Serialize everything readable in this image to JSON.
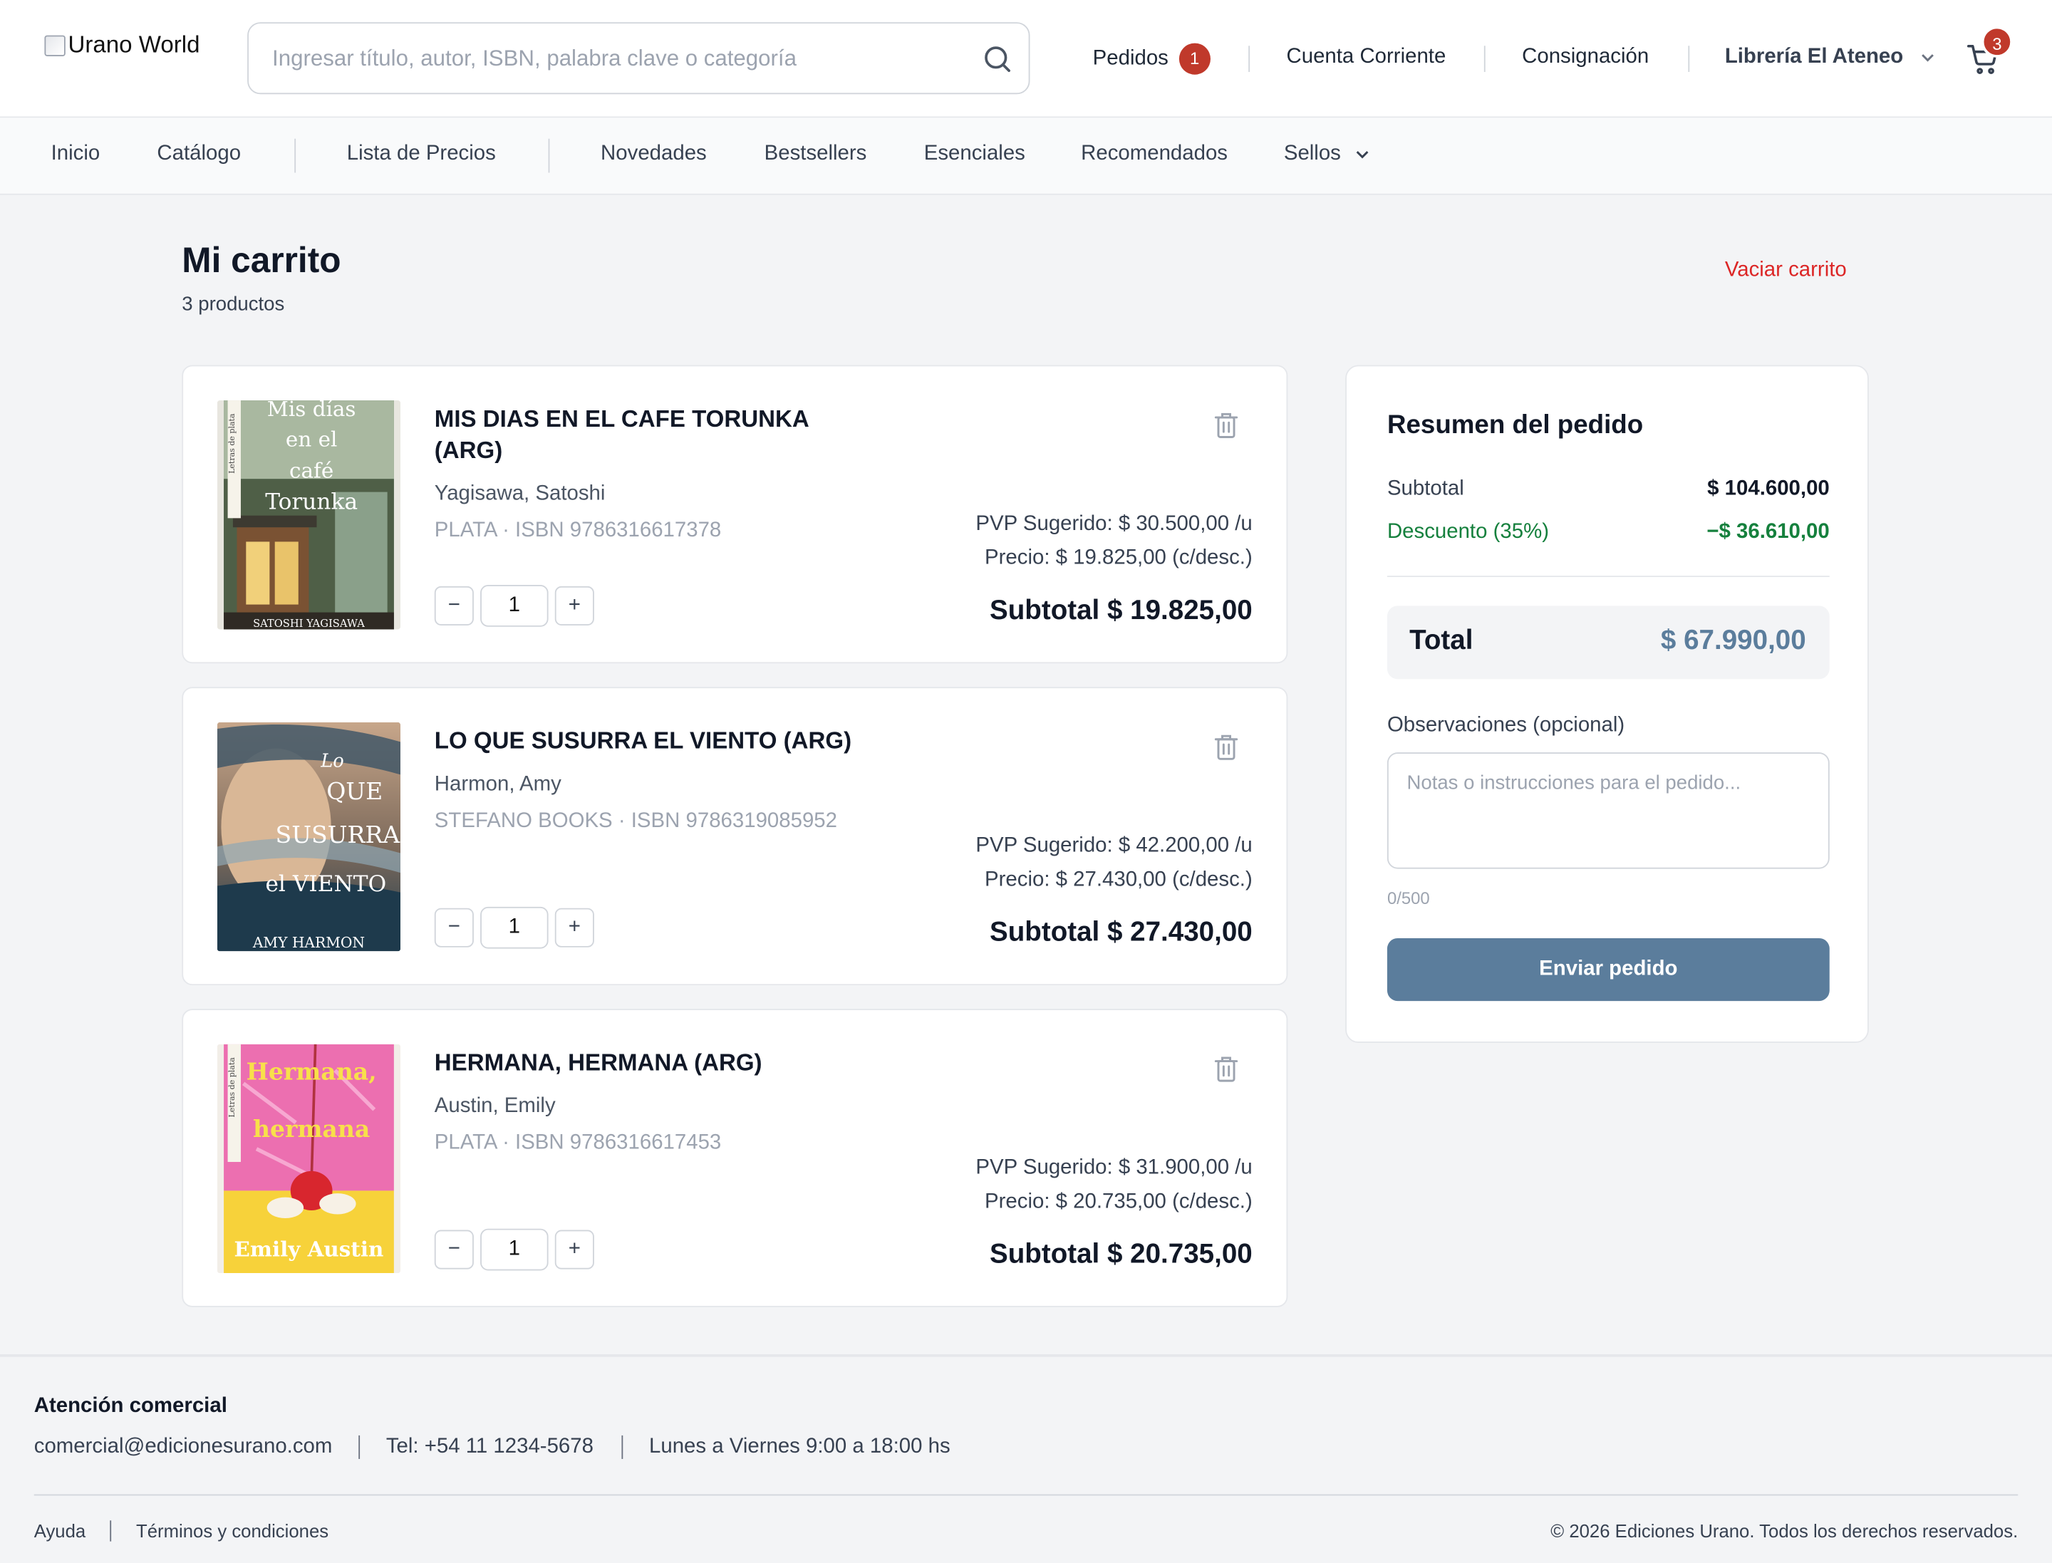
{
  "header": {
    "logo_alt": "Urano World",
    "search_placeholder": "Ingresar título, autor, ISBN, palabra clave o categoría",
    "nav": {
      "pedidos": "Pedidos",
      "pedidos_badge": "1",
      "cuenta": "Cuenta Corriente",
      "consignacion": "Consignación",
      "account": "Librería El Ateneo",
      "cart_badge": "3"
    }
  },
  "catbar": {
    "items": [
      "Inicio",
      "Catálogo",
      "Lista de Precios",
      "Novedades",
      "Bestsellers",
      "Esenciales",
      "Recomendados",
      "Sellos"
    ]
  },
  "cart": {
    "title": "Mi carrito",
    "count": "3 productos",
    "clear": "Vaciar carrito",
    "items": [
      {
        "title": "MIS DIAS EN EL CAFE TORUNKA (ARG)",
        "author": "Yagisawa, Satoshi",
        "meta": "PLATA · ISBN 9786316617378",
        "qty": "1",
        "pvp": "PVP Sugerido: $ 30.500,00 /u",
        "price": "Precio: $ 19.825,00 (c/desc.)",
        "subtotal": "Subtotal $ 19.825,00",
        "cover_title": "Mis días en el café Torunka",
        "cover_author": "SATOSHI YAGISAWA",
        "cover_spine": "Letras de plata"
      },
      {
        "title": "LO QUE SUSURRA EL VIENTO (ARG)",
        "author": "Harmon, Amy",
        "meta": "STEFANO BOOKS · ISBN 9786319085952",
        "qty": "1",
        "pvp": "PVP Sugerido: $ 42.200,00 /u",
        "price": "Precio: $ 27.430,00 (c/desc.)",
        "subtotal": "Subtotal $ 27.430,00",
        "cover_title_1": "Lo",
        "cover_title_2": "QUE",
        "cover_title_3": "SUSURRA",
        "cover_title_4": "el VIENTO",
        "cover_author": "AMY HARMON"
      },
      {
        "title": "HERMANA, HERMANA (ARG)",
        "author": "Austin, Emily",
        "meta": "PLATA · ISBN 9786316617453",
        "qty": "1",
        "pvp": "PVP Sugerido: $ 31.900,00 /u",
        "price": "Precio: $ 20.735,00 (c/desc.)",
        "subtotal": "Subtotal $ 20.735,00",
        "cover_title_1": "Hermana,",
        "cover_title_2": "hermana",
        "cover_author": "Emily Austin",
        "cover_spine": "Letras de plata"
      }
    ],
    "qty_minus": "−",
    "qty_plus": "+"
  },
  "summary": {
    "title": "Resumen del pedido",
    "subtotal_label": "Subtotal",
    "subtotal_value": "$ 104.600,00",
    "discount_label": "Descuento (35%)",
    "discount_value": "−$ 36.610,00",
    "total_label": "Total",
    "total_value": "$ 67.990,00",
    "notes_label": "Observaciones (opcional)",
    "notes_placeholder": "Notas o instrucciones para el pedido...",
    "char_count": "0/500",
    "send": "Enviar pedido"
  },
  "footer": {
    "heading": "Atención comercial",
    "email": "comercial@edicionesurano.com",
    "phone": "Tel: +54 11 1234-5678",
    "hours": "Lunes a Viernes 9:00 a 18:00 hs",
    "help": "Ayuda",
    "terms": "Términos y condiciones",
    "copyright": "© 2026 Ediciones Urano. Todos los derechos reservados."
  },
  "colors": {
    "accent": "#5b7d9c",
    "danger": "#dc2626",
    "badge": "#c0392b",
    "discount": "#15803d"
  }
}
